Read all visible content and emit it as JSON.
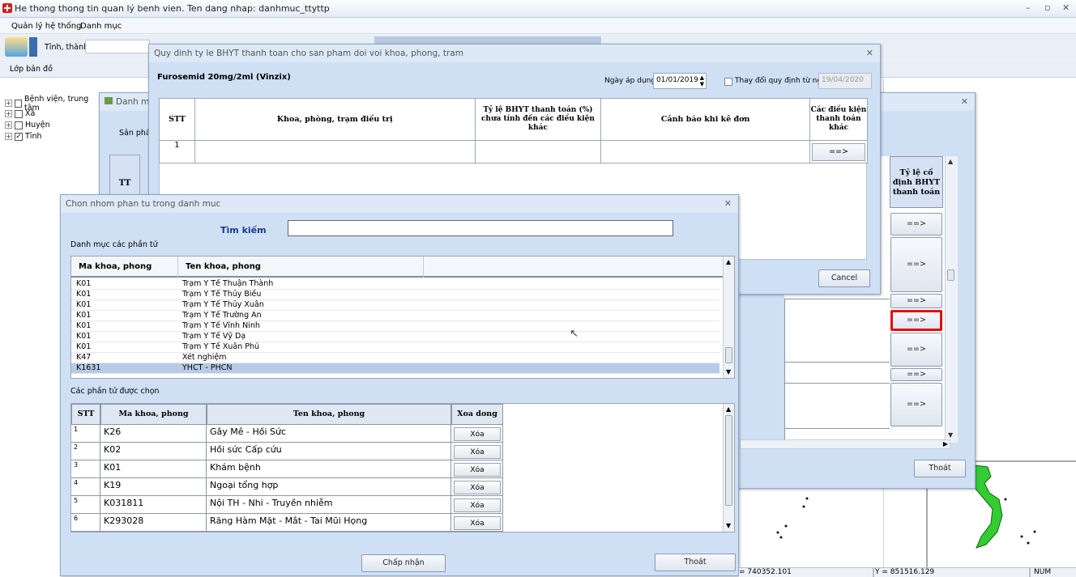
{
  "app": {
    "title": "He thong thong tin quan lý benh vien. Ten dang nhap: danhmuc_ttyttp",
    "menus": [
      "Quản lý hệ thống",
      "Danh mục"
    ],
    "province_label": "Tỉnh, thành:",
    "layer_label": "Lớp bản đồ"
  },
  "tree": {
    "items": [
      {
        "label": "Bệnh viện, trung tâm",
        "checked": false
      },
      {
        "label": "Xã",
        "checked": false
      },
      {
        "label": "Huyện",
        "checked": false
      },
      {
        "label": "Tỉnh",
        "checked": true
      }
    ]
  },
  "bg_window": {
    "title": "Danh m",
    "product_label": "Sản phẩm",
    "col_tt": "TT",
    "col_rate": "Tỷ lệ cố định BHYT thanh toán",
    "arrow": "==>",
    "exit": "Thoát"
  },
  "rule_window": {
    "title": "Quy dinh ty le BHYT thanh toan  cho san pham doi voi  khoa, phong, tram",
    "product": "Furosemid 20mg/2ml (Vinzix)",
    "date_label": "Ngày áp dụng",
    "date_value": "01/01/2019",
    "change_label": "Thay đổi quy định từ ngày",
    "change_value": "19/04/2020",
    "headers": {
      "stt": "STT",
      "dept": "Khoa, phòng, trạm điều trị",
      "rate": "Tỷ lệ BHYT thanh toán (%) chưa tính đến các điều kiện khác",
      "warn": "Cảnh báo khi kê đơn",
      "cond": "Các điều kiện thanh toán khác"
    },
    "row_stt": "1",
    "row_arrow": "==>",
    "cancel": "Cancel"
  },
  "select_window": {
    "title": "Chon nhom phan tu trong danh muc",
    "search_label": "Tìm kiếm",
    "search_value": "",
    "catalog_label": "Danh mục các phần tử",
    "list_headers": {
      "code": "Ma khoa, phong",
      "name": "Ten khoa, phong"
    },
    "list_rows": [
      {
        "code": "K01",
        "name": "Trạm Y Tế Thuận Thành"
      },
      {
        "code": "K01",
        "name": "Trạm Y Tế Thủy Biều"
      },
      {
        "code": "K01",
        "name": "Trạm Y Tế Thủy Xuân"
      },
      {
        "code": "K01",
        "name": "Trạm Y Tế Trường An"
      },
      {
        "code": "K01",
        "name": "Trạm Y Tế Vĩnh Ninh"
      },
      {
        "code": "K01",
        "name": "Trạm Y Tế Vỹ Dạ"
      },
      {
        "code": "K01",
        "name": "Trạm Y Tế Xuân Phú"
      },
      {
        "code": "K47",
        "name": "Xét nghiệm"
      },
      {
        "code": "K1631",
        "name": "YHCT - PHCN"
      }
    ],
    "selected_label": "Các phần tử được chọn",
    "sel_headers": {
      "stt": "STT",
      "code": "Ma khoa, phong",
      "name": "Ten khoa, phong",
      "del": "Xoa dong"
    },
    "sel_rows": [
      {
        "stt": "1",
        "code": "K26",
        "name": "Gây Mê - Hồi Sức",
        "del": "Xóa"
      },
      {
        "stt": "2",
        "code": "K02",
        "name": "Hồi sức Cấp cứu",
        "del": "Xóa"
      },
      {
        "stt": "3",
        "code": "K01",
        "name": "Khám bệnh",
        "del": "Xóa"
      },
      {
        "stt": "4",
        "code": "K19",
        "name": "Ngoại tổng hợp",
        "del": "Xóa"
      },
      {
        "stt": "5",
        "code": "K031811",
        "name": "Nội TH - Nhi - Truyền nhiễm",
        "del": "Xóa"
      },
      {
        "stt": "6",
        "code": "K293028",
        "name": "Răng Hàm Mặt - Mắt - Tai Mũi Họng",
        "del": "Xóa"
      }
    ],
    "accept": "Chấp nhận",
    "exit": "Thoát"
  },
  "status": {
    "x": "= 740352.101",
    "y": "Y = 851516.129",
    "num": "NUM"
  },
  "colors": {
    "highlight": "#e01010",
    "selected_row": "#b7cbe7",
    "map_land": "#33cc33"
  }
}
